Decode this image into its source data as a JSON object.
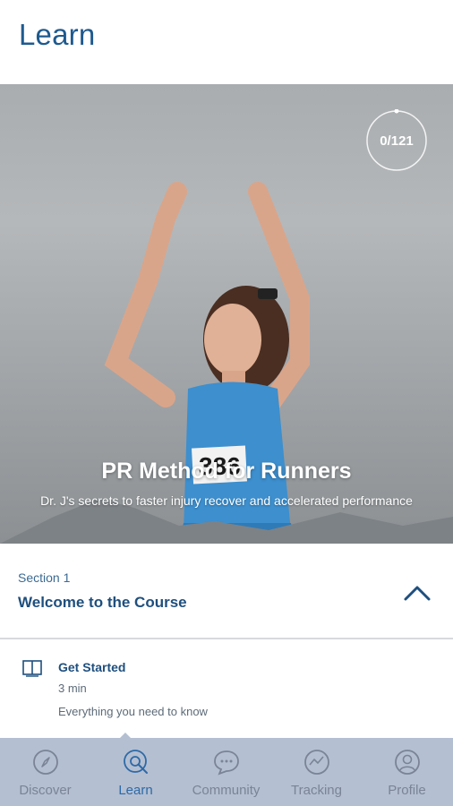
{
  "header": {
    "title": "Learn"
  },
  "hero": {
    "progress_text": "0/121",
    "progress_value": 0,
    "title": "PR Method for Runners",
    "subtitle": "Dr. J's secrets to faster injury recover and accelerated performance",
    "bib_number": "386"
  },
  "section": {
    "label": "Section 1",
    "title": "Welcome to the Course",
    "expanded": true
  },
  "lessons": [
    {
      "title": "Get Started",
      "duration": "3 min",
      "description": "Everything you need to know",
      "icon": "book-icon"
    }
  ],
  "tabs": [
    {
      "label": "Discover",
      "icon": "compass-icon",
      "active": false
    },
    {
      "label": "Learn",
      "icon": "learn-search-icon",
      "active": true
    },
    {
      "label": "Community",
      "icon": "chat-bubble-icon",
      "active": false
    },
    {
      "label": "Tracking",
      "icon": "tracking-graph-icon",
      "active": false
    },
    {
      "label": "Profile",
      "icon": "profile-icon",
      "active": false
    }
  ],
  "colors": {
    "accent": "#1e5a8f",
    "tabbar": "#b4bfd2",
    "active_tab": "#2e6aa6",
    "inactive_tab": "#7a8496"
  }
}
